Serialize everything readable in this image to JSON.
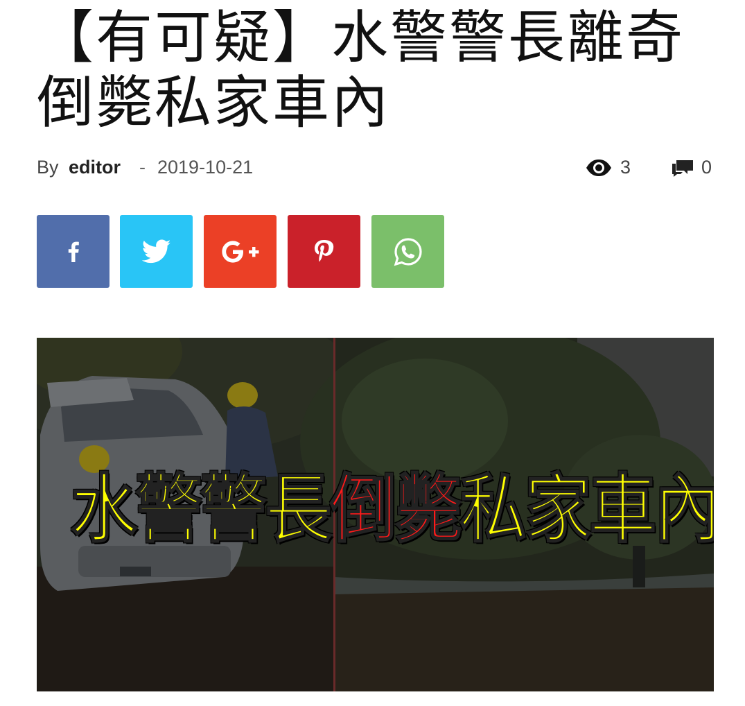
{
  "article": {
    "title": "【有可疑】水警警長離奇倒斃私家車內",
    "byline": {
      "by_label": "By",
      "author": "editor",
      "separator": "-",
      "date": "2019-10-21"
    },
    "stats": {
      "views": "3",
      "comments": "0",
      "views_icon": "eye-icon",
      "comments_icon": "comment-icon"
    }
  },
  "share": {
    "buttons": [
      {
        "network": "facebook",
        "icon": "facebook-icon",
        "color": "#516eab"
      },
      {
        "network": "twitter",
        "icon": "twitter-icon",
        "color": "#29c5f6"
      },
      {
        "network": "google-plus",
        "icon": "google-plus-icon",
        "color": "#eb4026"
      },
      {
        "network": "pinterest",
        "icon": "pinterest-icon",
        "color": "#ca212a"
      },
      {
        "network": "whatsapp",
        "icon": "whatsapp-icon",
        "color": "#7bbf6a"
      }
    ]
  },
  "hero": {
    "headline_parts": [
      {
        "text": "水警警長",
        "color": "#ffff00"
      },
      {
        "text": "倒斃",
        "color": "#ff1a1a"
      },
      {
        "text": "私家車內",
        "color": "#ffff00"
      }
    ]
  }
}
